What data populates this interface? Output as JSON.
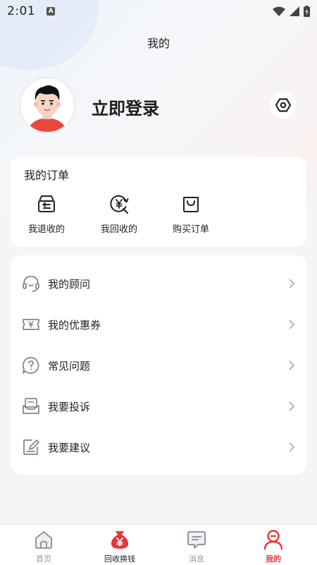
{
  "status_bar": {
    "time": "2:01",
    "notification_badge": "A"
  },
  "header": {
    "title": "我的"
  },
  "profile": {
    "login_text": "立即登录"
  },
  "orders": {
    "title": "我的订单",
    "items": [
      {
        "label": "我退收的",
        "icon": "return-box-icon"
      },
      {
        "label": "我回收的",
        "icon": "yuan-recycle-icon"
      },
      {
        "label": "购买订单",
        "icon": "shopping-bag-icon"
      }
    ]
  },
  "menu": {
    "items": [
      {
        "label": "我的顾问",
        "icon": "headset-icon"
      },
      {
        "label": "我的优惠券",
        "icon": "coupon-icon"
      },
      {
        "label": "常见问题",
        "icon": "question-icon"
      },
      {
        "label": "我要投诉",
        "icon": "complaint-mail-icon"
      },
      {
        "label": "我要建议",
        "icon": "edit-icon"
      }
    ]
  },
  "tabbar": {
    "items": [
      {
        "label": "首页",
        "icon": "home-icon"
      },
      {
        "label": "回收换钱",
        "icon": "money-bag-icon"
      },
      {
        "label": "消息",
        "icon": "message-icon"
      },
      {
        "label": "我的",
        "icon": "user-icon"
      }
    ],
    "active_index": 3
  },
  "colors": {
    "accent": "#e83a45",
    "icon_gray": "#888f99",
    "text": "#222222"
  }
}
